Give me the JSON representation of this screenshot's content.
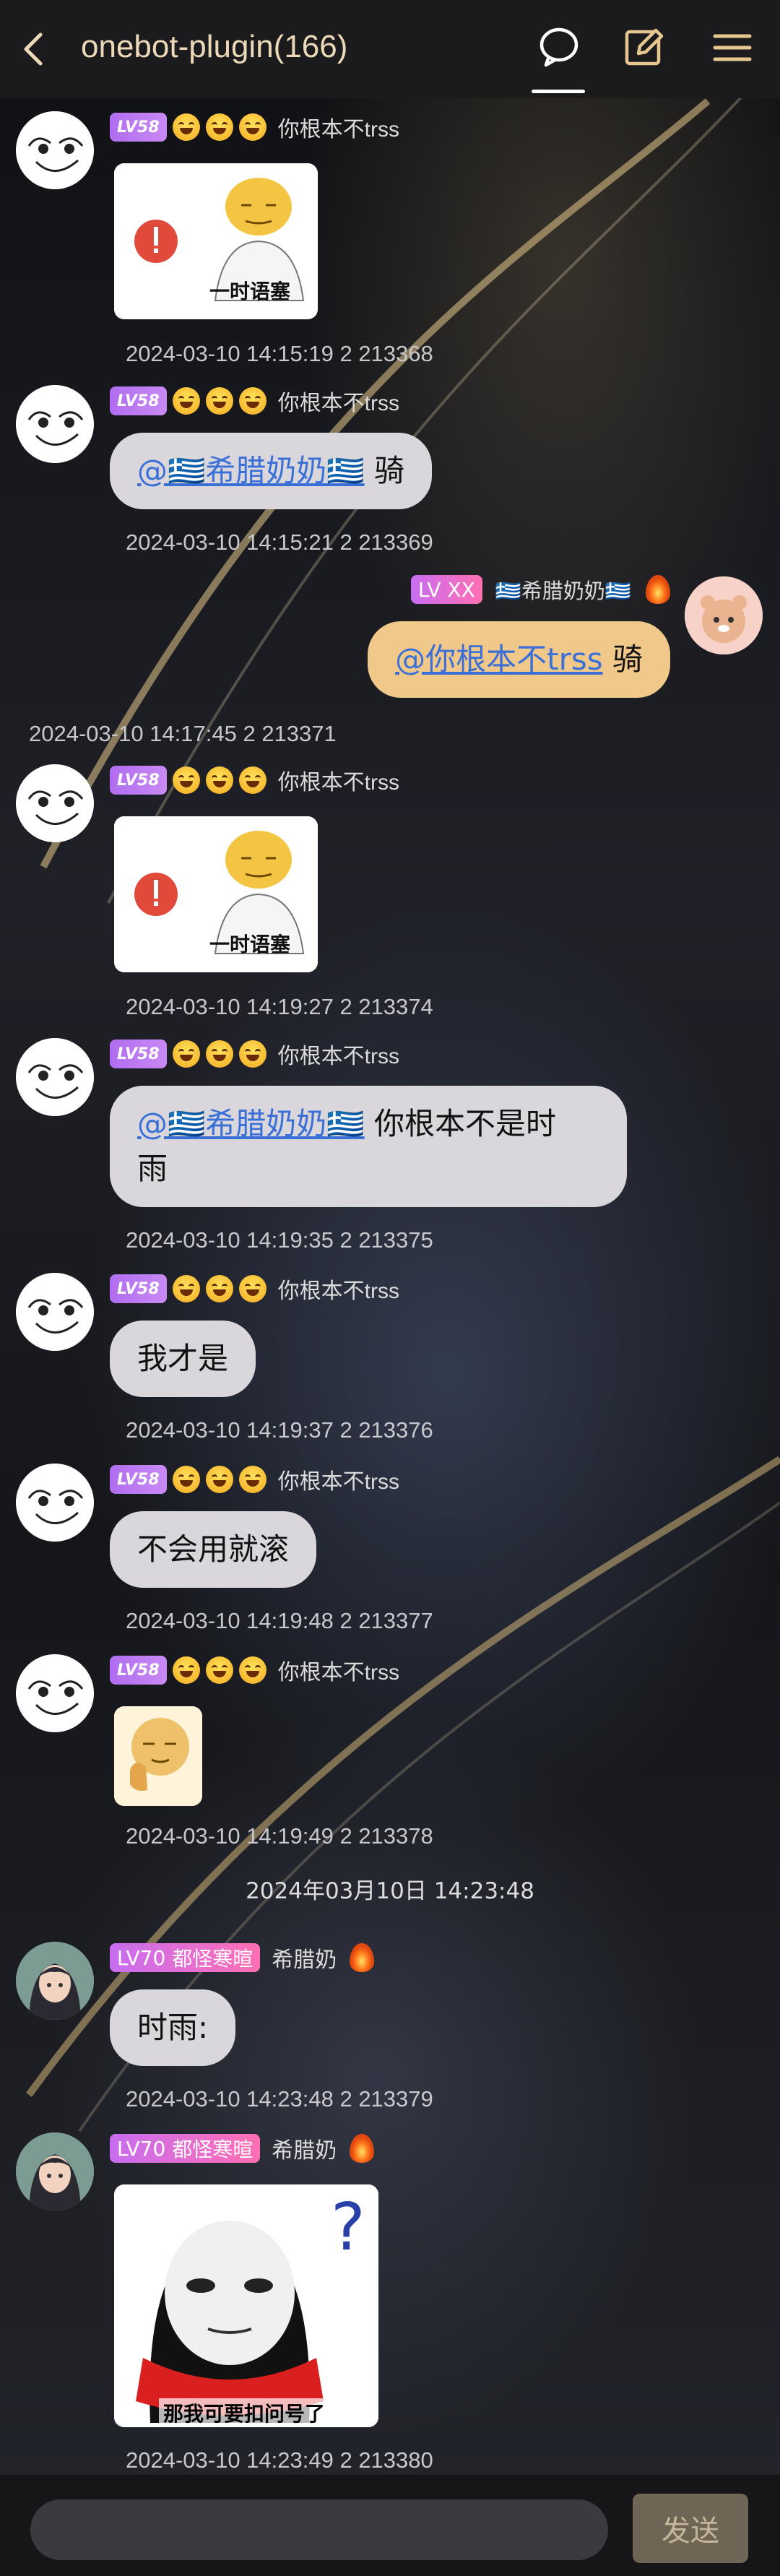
{
  "header": {
    "title": "onebot-plugin(166)"
  },
  "colors": {
    "header_bg": "#1b1b1e",
    "bubble_other": "#d9d7dc",
    "bubble_self": "#f0c98a",
    "mention": "#3b6fd8",
    "level_badge": "#b06df0",
    "send_button": "#6f6555"
  },
  "messages": [
    {
      "level": "LV58",
      "name": "你根本不trss",
      "sticker": "一时语塞",
      "timestamp": "2024-03-10 14:15:19 2 213368"
    },
    {
      "level": "LV58",
      "name": "你根本不trss",
      "mention": "@🇬🇷希腊奶奶🇬🇷",
      "text": " 骑",
      "timestamp": "2024-03-10 14:15:21 2 213369"
    },
    {
      "level": "LV",
      "title": "XX",
      "name": "🇬🇷希腊奶奶🇬🇷",
      "mention": "@你根本不trss",
      "text": " 骑",
      "timestamp": "2024-03-10 14:17:45 2 213371"
    },
    {
      "level": "LV58",
      "name": "你根本不trss",
      "sticker": "一时语塞",
      "timestamp": "2024-03-10 14:19:27 2 213374"
    },
    {
      "level": "LV58",
      "name": "你根本不trss",
      "mention": "@🇬🇷希腊奶奶🇬🇷",
      "text_line1": " 你根本不是时",
      "text_line2": "雨",
      "timestamp": "2024-03-10 14:19:35 2 213375"
    },
    {
      "level": "LV58",
      "name": "你根本不trss",
      "text": "我才是",
      "timestamp": "2024-03-10 14:19:37 2 213376"
    },
    {
      "level": "LV58",
      "name": "你根本不trss",
      "text": "不会用就滚",
      "timestamp": "2024-03-10 14:19:48 2 213377"
    },
    {
      "level": "LV58",
      "name": "你根本不trss",
      "timestamp": "2024-03-10 14:19:49 2 213378"
    },
    {
      "level": "LV70",
      "title": "都怪寒暄",
      "name": "希腊奶",
      "text": "时雨:",
      "timestamp": "2024-03-10 14:23:48 2 213379"
    },
    {
      "level": "LV70",
      "title": "都怪寒暄",
      "name": "希腊奶",
      "sticker": "那我可要扣问号了",
      "timestamp": "2024-03-10 14:23:49 2 213380"
    }
  ],
  "system_time": "2024年03月10日 14:23:48",
  "input": {
    "placeholder": ""
  },
  "send_label": "发送"
}
